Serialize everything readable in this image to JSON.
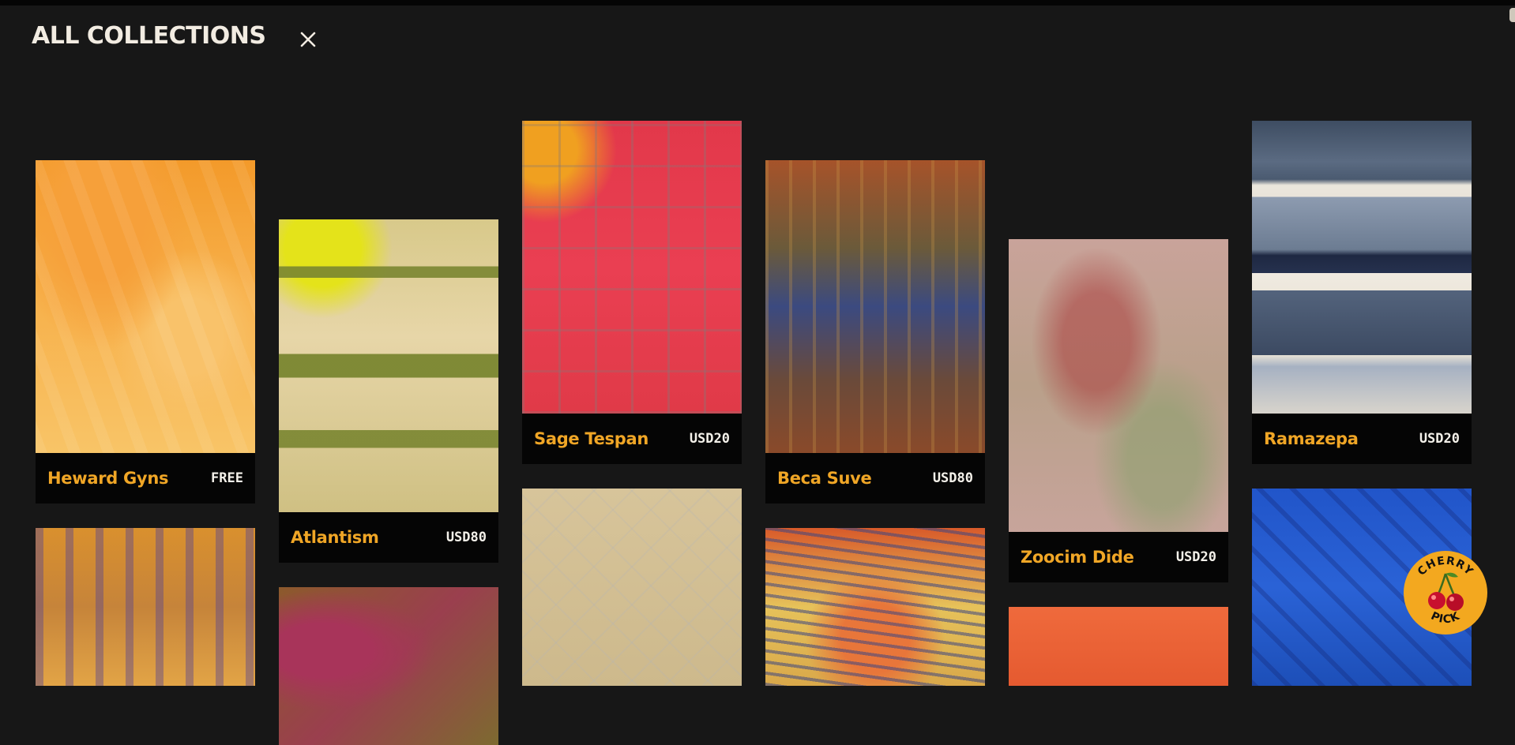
{
  "header": {
    "title": "ALL COLLECTIONS",
    "close_icon": "close-icon"
  },
  "rugs": [
    {
      "name": "Heward Gyns",
      "price": "FREE"
    },
    {
      "name": "Atlantism",
      "price": "USD80"
    },
    {
      "name": "Sage Tespan",
      "price": "USD20"
    },
    {
      "name": "Beca Suve",
      "price": "USD80"
    },
    {
      "name": "Zoocim Dide",
      "price": "USD20"
    },
    {
      "name": "Ramazepa",
      "price": "USD20"
    }
  ],
  "badge": {
    "top_text": "CHERRY",
    "bottom_text": "PICK",
    "icon": "cherry-icon"
  },
  "colors": {
    "background": "#171717",
    "caption_bg": "#050505",
    "accent": "#f0a626",
    "price": "#f4f1ea"
  }
}
